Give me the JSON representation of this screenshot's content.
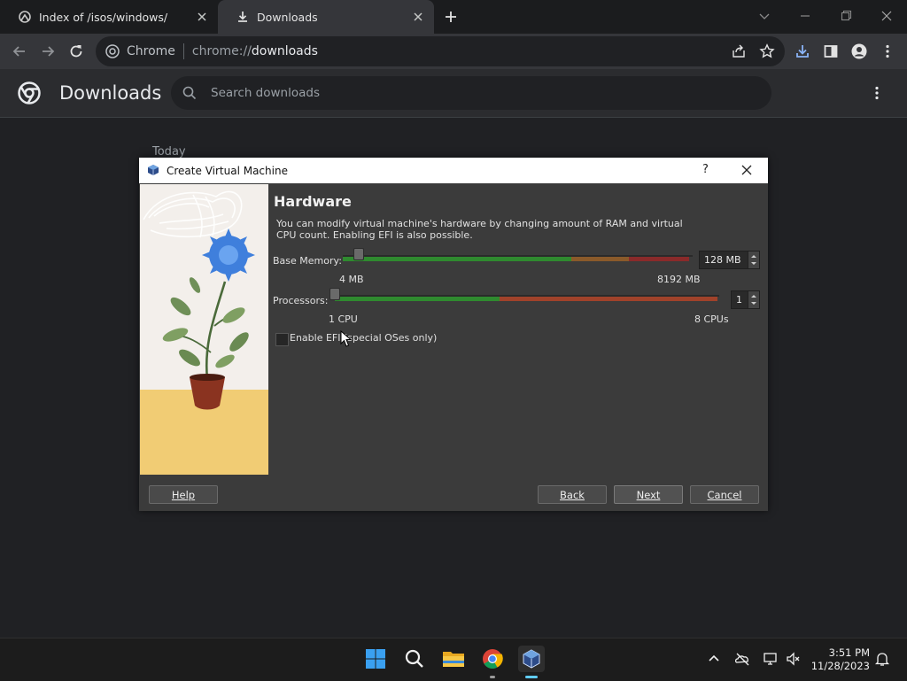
{
  "browser": {
    "tabs": [
      {
        "label": "Index of /isos/windows/"
      },
      {
        "label": "Downloads",
        "active": true
      }
    ],
    "omnibox": {
      "site": "Chrome",
      "url_prefix": "chrome://",
      "url_page": "downloads"
    }
  },
  "downloads": {
    "title": "Downloads",
    "search_placeholder": "Search downloads",
    "section": "Today"
  },
  "dialog": {
    "title": "Create Virtual Machine",
    "help_symbol": "?",
    "heading": "Hardware",
    "description": "You can modify virtual machine's hardware by changing amount of RAM and virtual CPU count. Enabling EFI is also possible.",
    "memory": {
      "label": "Base Memory:",
      "min": "4 MB",
      "max": "8192 MB",
      "value": "128 MB",
      "fraction": 0.016
    },
    "processors": {
      "label": "Processors:",
      "min": "1 CPU",
      "max": "8 CPUs",
      "value": "1",
      "fraction": 0.0
    },
    "efi": {
      "label": "Enable EFI (special OSes only)",
      "checked": false
    },
    "buttons": {
      "help": "Help",
      "back": "Back",
      "next": "Next",
      "cancel": "Cancel"
    }
  },
  "taskbar": {
    "time": "3:51 PM",
    "date": "11/28/2023"
  },
  "colors": {
    "accent": "#60cdff",
    "green": "#2f8a2f",
    "red": "#a0422a"
  }
}
